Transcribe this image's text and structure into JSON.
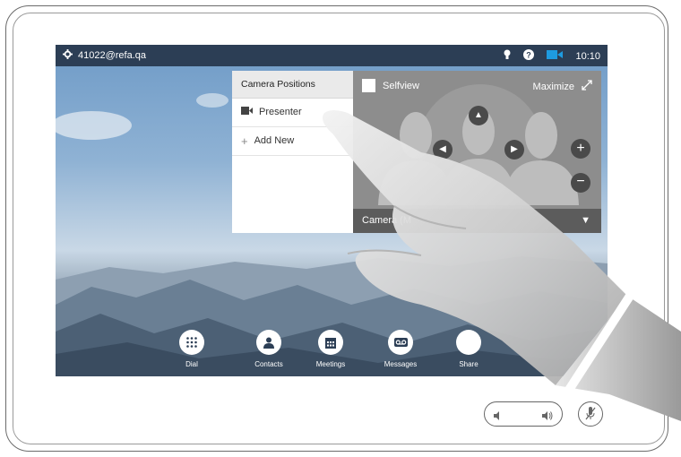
{
  "status_bar": {
    "address": "41022@refa.qa",
    "time": "10:10",
    "icons": [
      "gear-icon",
      "lightbulb-icon",
      "help-icon",
      "camera-icon"
    ]
  },
  "camera_positions": {
    "title": "Camera Positions",
    "items": [
      {
        "label": "Presenter",
        "icon": "camera-icon"
      },
      {
        "label": "Add New",
        "icon": "plus-icon"
      }
    ]
  },
  "selfview": {
    "label": "Selfview",
    "maximize_label": "Maximize",
    "camera_select_label": "Camera (M"
  },
  "dock": {
    "items": [
      {
        "label": "Dial",
        "icon": "keypad-icon"
      },
      {
        "label": "Contacts",
        "icon": "person-icon"
      },
      {
        "label": "Meetings",
        "icon": "calendar-icon"
      },
      {
        "label": "Messages",
        "icon": "voicemail-icon"
      },
      {
        "label": "Share",
        "icon": "share-icon"
      }
    ]
  },
  "colors": {
    "status_bar": "#2c3e55",
    "selfview_panel": "#8d8d8d",
    "menu_background": "#ffffff"
  }
}
